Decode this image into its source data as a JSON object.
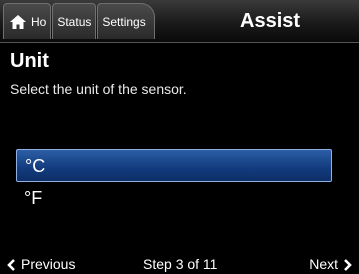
{
  "header": {
    "tabs": [
      {
        "label": "Ho",
        "icon": "home-icon"
      },
      {
        "label": "Status"
      },
      {
        "label": "Settings"
      }
    ],
    "title": "Assist"
  },
  "page": {
    "heading": "Unit",
    "description": "Select the unit of the sensor."
  },
  "options": {
    "items": [
      {
        "label": "°C",
        "selected": true
      },
      {
        "label": "°F",
        "selected": false
      }
    ],
    "selected_color": "#1c4a91"
  },
  "footer": {
    "previous_label": "Previous",
    "step_label": "Step 3 of 11",
    "next_label": "Next"
  }
}
